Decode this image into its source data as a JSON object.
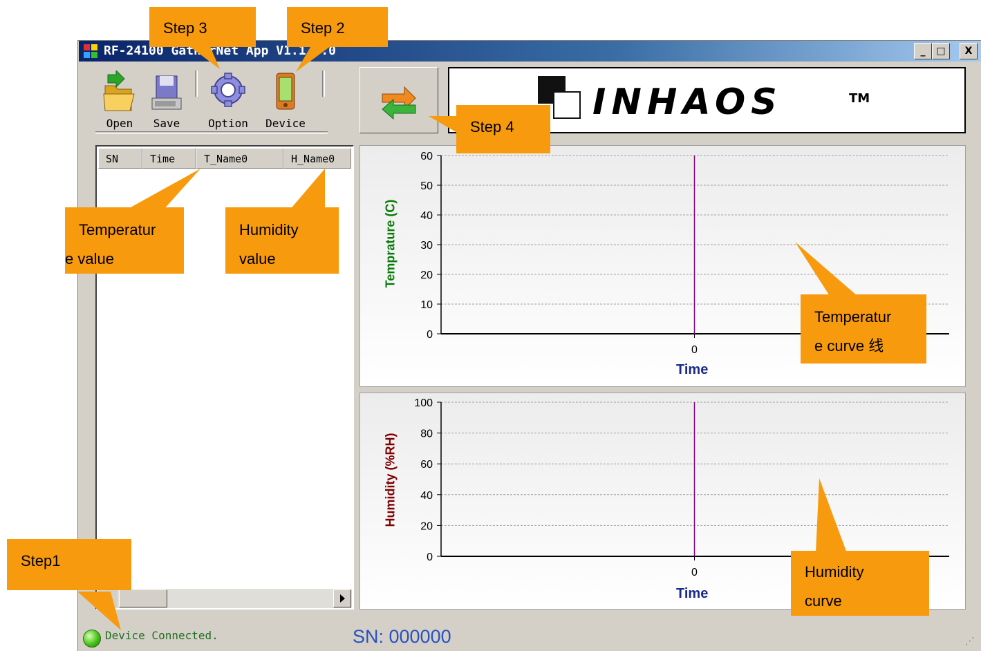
{
  "window": {
    "title": "RF-24100 GatherNet App V1.1.0.0",
    "caption_buttons": [
      "_",
      "□",
      "X"
    ]
  },
  "toolbar": {
    "items": [
      {
        "label": "Open",
        "icon": "open-folder-icon"
      },
      {
        "label": "Save",
        "icon": "save-disk-icon"
      },
      {
        "label": "Option",
        "icon": "gear-icon"
      },
      {
        "label": "Device",
        "icon": "device-icon"
      }
    ],
    "refresh_icon": "refresh-arrows-icon"
  },
  "logo": {
    "text": "INHAOS",
    "tm": "TM"
  },
  "list": {
    "columns": [
      "SN",
      "Time",
      "T_Name0",
      "H_Name0"
    ],
    "rows": []
  },
  "status": {
    "connection": "Device Connected.",
    "sn": "SN: 000000",
    "led_color": "#46c21a"
  },
  "annotations": {
    "step1": "Step1",
    "step2": "Step 2",
    "step3": "Step 3",
    "step4": "Step 4",
    "temp_value": [
      "Temperatur",
      "e value"
    ],
    "humidity_value": [
      "Humidity",
      "value"
    ],
    "temp_curve": [
      "Temperatur",
      "e curve 线"
    ],
    "humidity_curve": [
      "Humidity",
      "curve"
    ],
    "color": "#f79a0e"
  },
  "chart_data": [
    {
      "type": "line",
      "xlabel": "Time",
      "ylabel": "Temprature (C)",
      "ylabel_color": "#0a7a0a",
      "ylim": [
        0,
        60
      ],
      "yticks": [
        "0",
        "10",
        "20",
        "30",
        "40",
        "50",
        "60"
      ],
      "xticks": [
        "0"
      ],
      "series": [
        {
          "values": []
        }
      ],
      "cursor_x": 0,
      "cursor_color": "#800080",
      "grid": true
    },
    {
      "type": "line",
      "xlabel": "Time",
      "ylabel": "Humidity (%RH)",
      "ylabel_color": "#800000",
      "ylim": [
        0,
        100
      ],
      "yticks": [
        "0",
        "20",
        "40",
        "60",
        "80",
        "100"
      ],
      "xticks": [
        "0"
      ],
      "series": [
        {
          "values": []
        }
      ],
      "cursor_x": 0,
      "cursor_color": "#800080",
      "grid": true
    }
  ]
}
